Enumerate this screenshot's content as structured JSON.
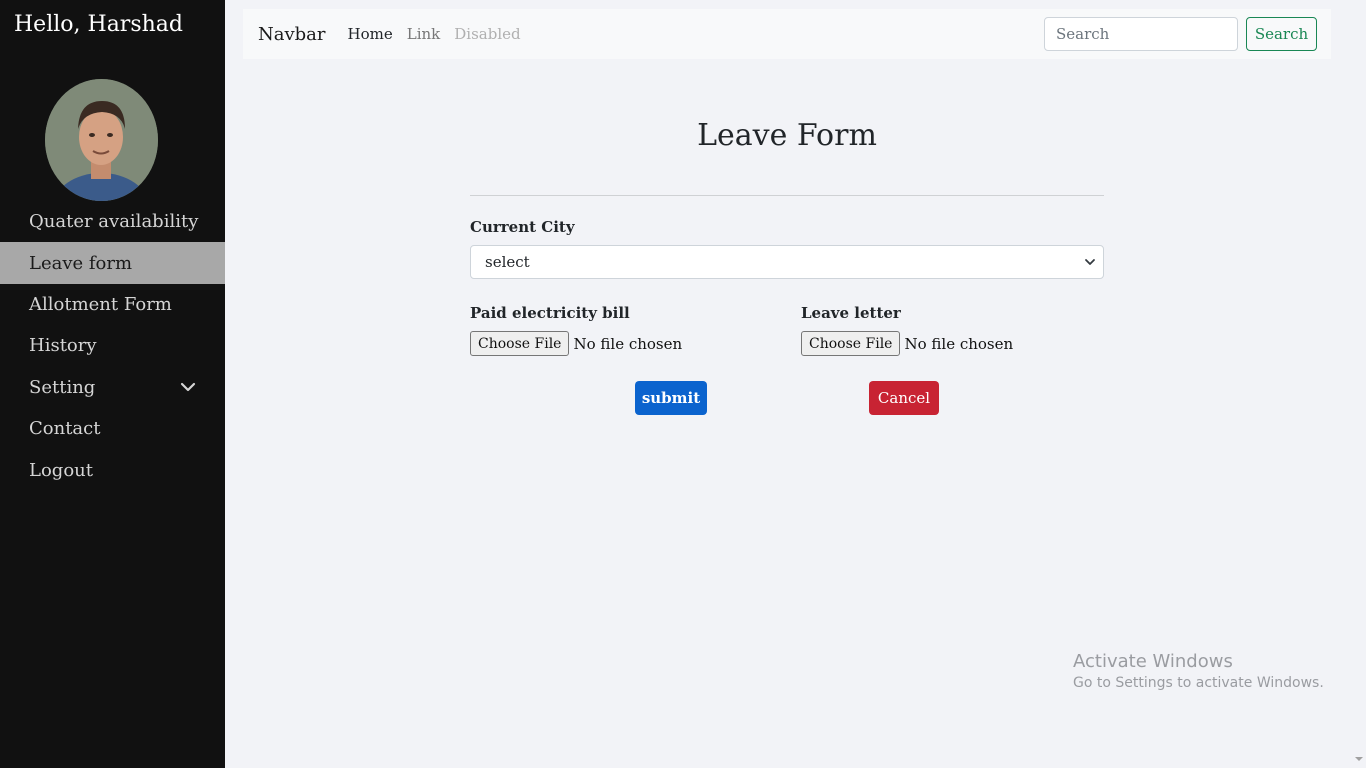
{
  "sidebar": {
    "greeting": "Hello, Harshad",
    "items": [
      {
        "label": "Quater availability"
      },
      {
        "label": "Leave form"
      },
      {
        "label": "Allotment Form"
      },
      {
        "label": "History"
      },
      {
        "label": "Setting"
      },
      {
        "label": "Contact"
      },
      {
        "label": "Logout"
      }
    ]
  },
  "navbar": {
    "brand": "Navbar",
    "links": [
      "Home",
      "Link",
      "Disabled"
    ],
    "search_placeholder": "Search",
    "search_button": "Search"
  },
  "form": {
    "title": "Leave Form",
    "city_label": "Current City",
    "city_value": "select",
    "bill_label": "Paid electricity bill",
    "letter_label": "Leave letter",
    "choose_file": "Choose File",
    "no_file": "No file chosen",
    "submit": "submit",
    "cancel": "Cancel"
  },
  "watermark": {
    "title": "Activate Windows",
    "subtitle": "Go to Settings to activate Windows."
  },
  "colors": {
    "sidebar_bg": "#111111",
    "active_item_bg": "#a8a8a8",
    "submit_bg": "#0b63ce",
    "cancel_bg": "#c82333",
    "search_green": "#198754"
  }
}
